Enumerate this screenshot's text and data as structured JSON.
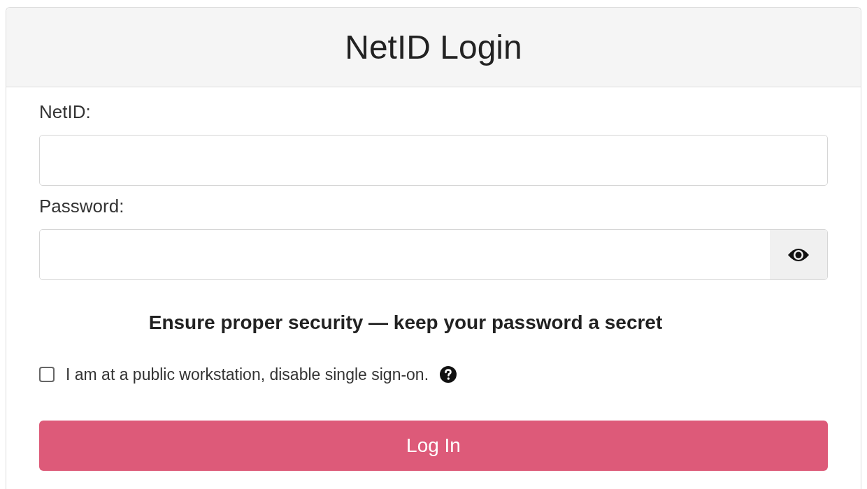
{
  "header": {
    "title": "NetID Login"
  },
  "fields": [
    {
      "label": "NetID:",
      "kind": "text"
    },
    {
      "label": "Password:",
      "kind": "password"
    }
  ],
  "notice": "Ensure proper security — keep your password a secret",
  "option": {
    "label": "I am at a public workstation, disable single sign-on.",
    "checked": false
  },
  "submit": "Log In"
}
